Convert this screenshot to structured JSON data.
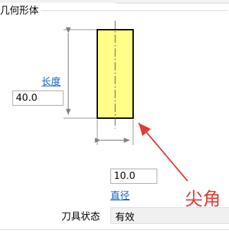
{
  "group": {
    "title": "几何形体"
  },
  "length": {
    "label": "长度",
    "value": "40.0"
  },
  "diameter": {
    "label": "直径",
    "value": "10.0"
  },
  "annotation": {
    "text": "尖角"
  },
  "tool_state": {
    "label": "刀具状态",
    "value": "有效"
  },
  "colors": {
    "tool_fill": "#ffff88",
    "link": "#1565c0",
    "annotation": "#e53935"
  }
}
